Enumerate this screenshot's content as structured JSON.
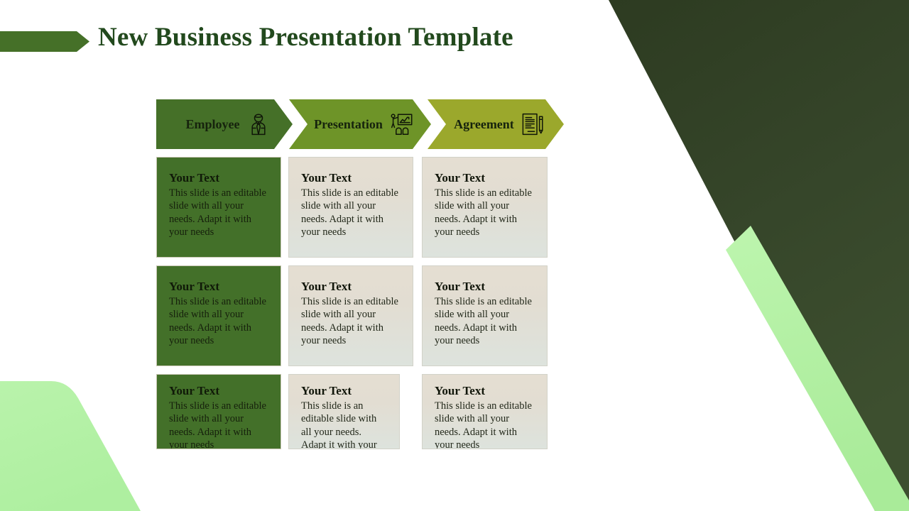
{
  "slide": {
    "title": "New Business Presentation Template",
    "background_color": "#ffffff"
  },
  "theme": {
    "title_color": "#22491d",
    "dark_green": "#2f3d23",
    "step_1_color": "#457028",
    "step_2_color": "#6e9428",
    "step_3_color": "#9ba82c",
    "light_green": "#b2f0a4",
    "card_dark_color": "#437029",
    "card_light_top": "#e5ded2",
    "card_light_bottom": "#dde3dd"
  },
  "steps": [
    {
      "label": "Employee",
      "icon": "employee-icon"
    },
    {
      "label": "Presentation",
      "icon": "presentation-icon"
    },
    {
      "label": "Agreement",
      "icon": "agreement-icon"
    }
  ],
  "cards": {
    "title": "Your Text",
    "body": "This slide is an editable slide with all your needs. Adapt it with your needs",
    "rows": [
      [
        {
          "title": "Your Text",
          "body": "This slide is an editable slide with all your needs. Adapt it with your needs",
          "style": "dark"
        },
        {
          "title": "Your Text",
          "body": "This slide is an editable slide with all your needs. Adapt it with your needs",
          "style": "light"
        },
        {
          "title": "Your Text",
          "body": "This slide is an editable slide with all your needs. Adapt it with your needs",
          "style": "light"
        }
      ],
      [
        {
          "title": "Your Text",
          "body": "This slide is an editable slide with all your needs. Adapt it with your needs",
          "style": "dark"
        },
        {
          "title": "Your Text",
          "body": "This slide is an editable slide with all your needs. Adapt it with your needs",
          "style": "light"
        },
        {
          "title": "Your Text",
          "body": "This slide is an editable slide with all your needs. Adapt it with your needs",
          "style": "light"
        }
      ],
      [
        {
          "title": "Your Text",
          "body": "This slide is an editable slide with all your needs. Adapt it with your needs",
          "style": "dark"
        },
        {
          "title": "Your Text",
          "body": "This slide is an editable slide with all your needs. Adapt it with your needs",
          "style": "light"
        },
        {
          "title": "Your Text",
          "body": "This slide is an editable slide with all your needs. Adapt it with your needs",
          "style": "light"
        }
      ]
    ]
  }
}
